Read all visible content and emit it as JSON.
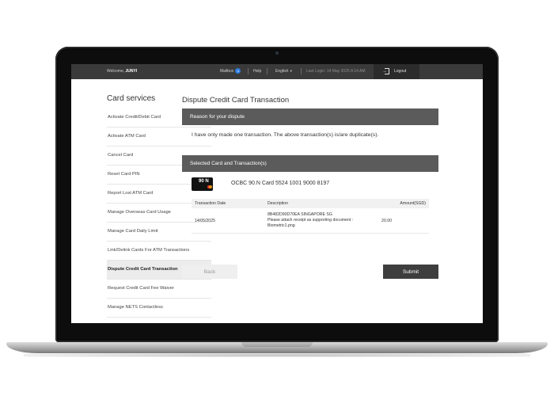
{
  "topbar": {
    "welcome_prefix": "Welcome,",
    "welcome_name": "JUNYI",
    "mailbox_label": "Mailbox",
    "mailbox_count": "4",
    "help_label": "Help",
    "language": "English",
    "last_login": "Last Login: 14 May 2025 8:14 AM",
    "logout_label": "Logout"
  },
  "sidebar": {
    "title": "Card services",
    "items": [
      {
        "label": "Activate Credit/Debit Card"
      },
      {
        "label": "Activate ATM Card"
      },
      {
        "label": "Cancel Card"
      },
      {
        "label": "Reset Card PIN"
      },
      {
        "label": "Report Lost ATM Card"
      },
      {
        "label": "Manage Overseas Card Usage"
      },
      {
        "label": "Manage Card Daily Limit"
      },
      {
        "label": "Link/Delink Cards For ATM Transactions"
      },
      {
        "label": "Dispute Credit Card Transaction",
        "active": true
      },
      {
        "label": "Request Credit Card Fee Waiver"
      },
      {
        "label": "Manage NETS Contactless"
      }
    ]
  },
  "main": {
    "page_title": "Dispute Credit Card Transaction",
    "reason_header": "Reason for your dispute",
    "reason_text": "I have only made one transaction. The above transaction(s) is/are duplicate(s).",
    "selected_header": "Selected Card and Transaction(s)",
    "card_image_text": "90 N",
    "card_label": "OCBC 90.N Card 5524 1001 9000 8197",
    "table": {
      "headers": [
        "Transaction Date",
        "Description",
        "Amount(SGD)"
      ],
      "rows": [
        {
          "date": "14/05/2025",
          "description_line1": "8B482D90D70EA SINGAPORE SG",
          "description_line2": "Please attach receipt as supporting document : Biometric1.png",
          "amount": "20.00"
        }
      ]
    },
    "back_label": "Back",
    "submit_label": "Submit"
  }
}
